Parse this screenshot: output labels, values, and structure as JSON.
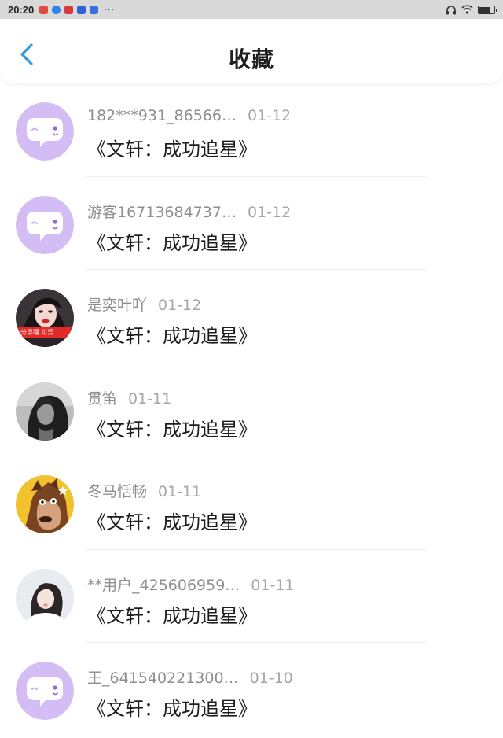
{
  "status_bar": {
    "time": "20:20",
    "app_icons": [
      {
        "name": "red-app-icon",
        "color": "#e04a3f"
      },
      {
        "name": "blue-circle-app-icon",
        "color": "#2f80ed"
      },
      {
        "name": "red-mail-app-icon",
        "color": "#d9363e"
      },
      {
        "name": "blue-app-icon",
        "color": "#2a63d6"
      },
      {
        "name": "blue-stack-app-icon",
        "color": "#3b6fe0"
      }
    ],
    "more": "···",
    "right_icons": [
      "headphones-icon",
      "wifi-icon",
      "battery-icon"
    ]
  },
  "header": {
    "title": "收藏",
    "back_icon": "chevron-left-icon",
    "accent_color": "#2e9cdf"
  },
  "favorites": [
    {
      "author": "182***931_86566…",
      "date": "01-12",
      "title": "《文轩：成功追星》",
      "avatar": "default-chat-avatar"
    },
    {
      "author": "游客16713684737…",
      "date": "01-12",
      "title": "《文轩：成功追星》",
      "avatar": "default-chat-avatar"
    },
    {
      "author": "是奕叶吖",
      "date": "01-12",
      "title": "《文轩：成功追星》",
      "avatar": "photo-avatar-girl-red"
    },
    {
      "author": "贯笛",
      "date": "01-11",
      "title": "《文轩：成功追星》",
      "avatar": "photo-avatar-bw-girl"
    },
    {
      "author": "冬马恬畅",
      "date": "01-11",
      "title": "《文轩：成功追星》",
      "avatar": "cartoon-horse-avatar"
    },
    {
      "author": "**用户_425606959…",
      "date": "01-11",
      "title": "《文轩：成功追星》",
      "avatar": "photo-avatar-girl-light"
    },
    {
      "author": "王_641540221300…",
      "date": "01-10",
      "title": "《文轩：成功追星》",
      "avatar": "default-chat-avatar"
    }
  ]
}
